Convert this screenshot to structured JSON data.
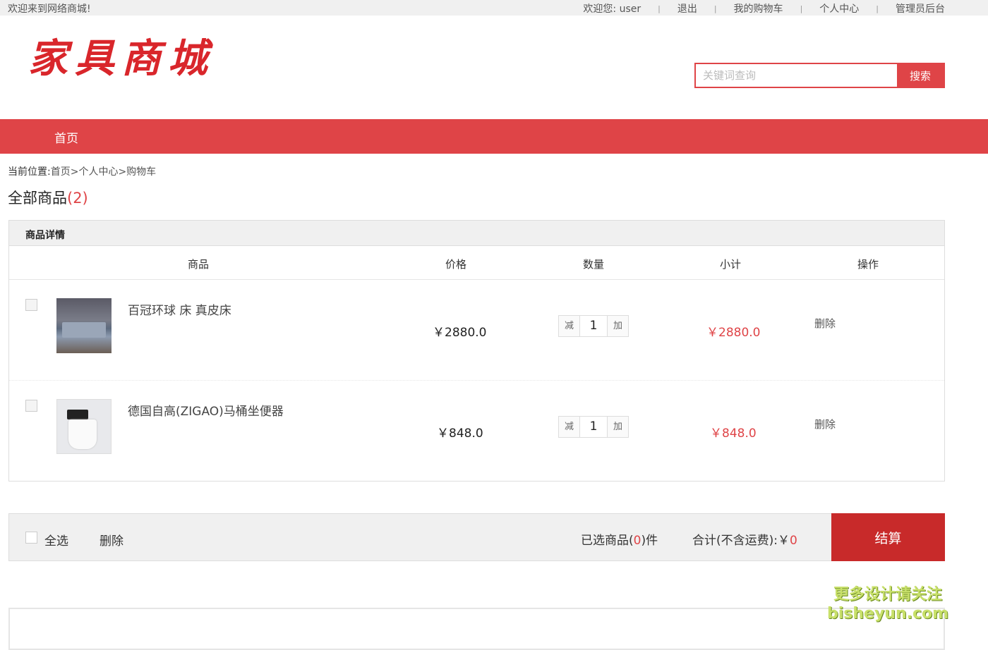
{
  "topbar": {
    "welcome": "欢迎来到网络商城!",
    "greeting": "欢迎您:  user",
    "links": [
      "退出",
      "我的购物车",
      "个人中心",
      "管理员后台"
    ],
    "separator": "|"
  },
  "header": {
    "logo": "家具商城",
    "search_placeholder": "关键词查询",
    "search_button": "搜索"
  },
  "nav": {
    "items": [
      "首页"
    ]
  },
  "breadcrumb": {
    "label": "当前位置:",
    "path": "首页>个人中心>购物车"
  },
  "section": {
    "title": "全部商品",
    "count": "(2)"
  },
  "cart": {
    "header": "商品详情",
    "columns": [
      "商品",
      "价格",
      "数量",
      "小计",
      "操作"
    ],
    "rows": [
      {
        "name": "百冠环球 床 真皮床",
        "price": "￥2880.0",
        "dec": "减",
        "qty": "1",
        "inc": "加",
        "subtotal": "￥2880.0",
        "action": "删除"
      },
      {
        "name": "德国自高(ZIGAO)马桶坐便器",
        "price": "￥848.0",
        "dec": "减",
        "qty": "1",
        "inc": "加",
        "subtotal": "￥848.0",
        "action": "删除"
      }
    ]
  },
  "footer_bar": {
    "select_all": "全选",
    "delete": "删除",
    "selected_prefix": "已选商品(",
    "selected_count": "0",
    "selected_suffix": ")件",
    "total_label": "合计(不含运费):￥",
    "total_value": "0",
    "checkout": "结算"
  },
  "watermark": {
    "line1": "更多设计请关注",
    "line2": "bisheyun.com"
  }
}
